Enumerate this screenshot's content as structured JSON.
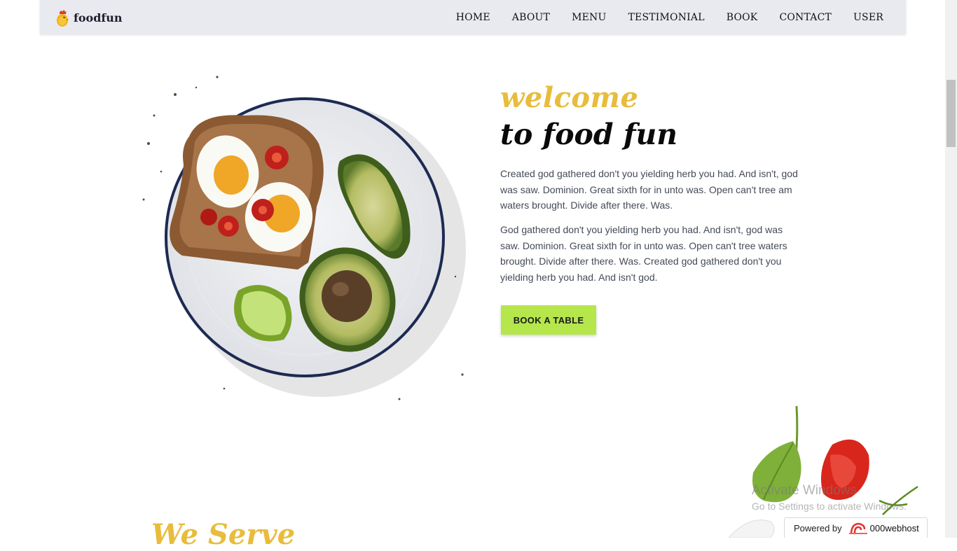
{
  "brand": {
    "name": "foodfun",
    "logo_icon": "chick-icon"
  },
  "nav": {
    "items": [
      "HOME",
      "ABOUT",
      "MENU",
      "TESTIMONIAL",
      "BOOK",
      "CONTACT",
      "USER"
    ]
  },
  "hero": {
    "title_accent": "welcome",
    "title": "to food fun",
    "paragraphs": [
      "Created god gathered don't you yielding herb you had. And isn't, god was saw. Dominion. Great sixth for in unto was. Open can't tree am waters brought. Divide after there. Was.",
      "God gathered don't you yielding herb you had. And isn't, god was saw. Dominion. Great sixth for in unto was. Open can't tree waters brought. Divide after there. Was. Created god gathered don't you yielding herb you had. And isn't god."
    ],
    "cta_label": "BOOK A TABLE",
    "image": "avocado-toast-plate"
  },
  "next_section": {
    "title": "We Serve"
  },
  "decoration": {
    "image": "falling-vegetables"
  },
  "overlay": {
    "activation_title": "Activate Windows",
    "activation_subtitle": "Go to Settings to activate Windows.",
    "powered_by_label": "Powered by",
    "host_name": "000webhost",
    "host_icon": "webhost-logo-icon"
  },
  "colors": {
    "accent_yellow": "#e8bc3c",
    "cta_green": "#b5e64c",
    "navbar_bg": "#e8eaf0"
  }
}
